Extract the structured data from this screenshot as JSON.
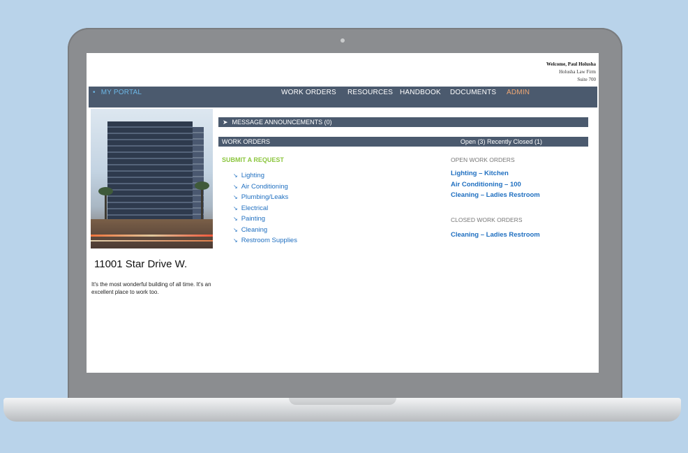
{
  "header": {
    "welcome": "Welcome, Paul Holusha",
    "company": "Holusha Law Firm",
    "suite": "Suite 700"
  },
  "nav": {
    "portal": "MY PORTAL",
    "items": [
      "WORK ORDERS",
      "RESOURCES",
      "HANDBOOK",
      "DOCUMENTS",
      "ADMIN"
    ]
  },
  "building": {
    "address": "11001 Star Drive W.",
    "description": "It's the most wonderful building of all time.   It's an excellent place to work too."
  },
  "announcements": {
    "label": "MESSAGE ANNOUNCEMENTS (0)"
  },
  "work_orders": {
    "label": "WORK ORDERS",
    "open_tab": "Open (3)",
    "closed_tab": "Recently Closed (1)",
    "submit_title": "SUBMIT A REQUEST",
    "request_types": [
      "Lighting",
      "Air Conditioning",
      "Plumbing/Leaks",
      "Electrical",
      "Painting",
      "Cleaning",
      "Restroom Supplies"
    ],
    "open_header": "OPEN WORK ORDERS",
    "open_items": [
      "Lighting – Kitchen",
      "Air Conditioning – 100",
      "Cleaning – Ladies Restroom"
    ],
    "closed_header": "CLOSED WORK ORDERS",
    "closed_items": [
      "Cleaning – Ladies Restroom"
    ]
  },
  "colors": {
    "navbar": "#4b5a6e",
    "link": "#1f6fc0",
    "submit_accent": "#8cc63f",
    "admin_accent": "#f0a874",
    "portal_accent": "#6cb7e6"
  }
}
